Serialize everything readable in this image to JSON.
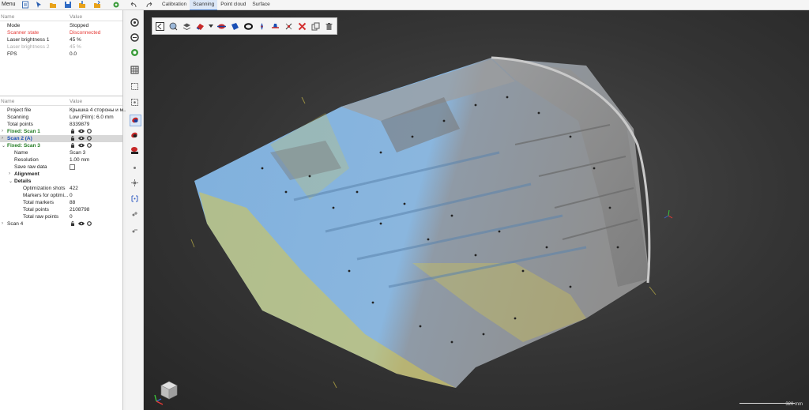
{
  "topbar": {
    "menu_label": "Menu",
    "quick_icons": [
      "new-project-icon",
      "scanner-icon",
      "open-folder-icon",
      "save-icon",
      "import-folder-icon",
      "export-folder-icon",
      "settings-icon",
      "undo-icon",
      "redo-icon"
    ],
    "tabs": [
      "Calibration",
      "Scanning",
      "Point cloud",
      "Surface"
    ],
    "active_tab": "Scanning"
  },
  "scanner_panel": {
    "col_name": "Name",
    "col_value": "Value",
    "rows": [
      {
        "name": "Mode",
        "value": "Stopped",
        "state": "normal"
      },
      {
        "name": "Scanner state",
        "value": "Disconnected",
        "state": "error"
      },
      {
        "name": "Laser brightness 1",
        "value": "45 %",
        "state": "normal"
      },
      {
        "name": "Laser brightness 2",
        "value": "45 %",
        "state": "disabled"
      },
      {
        "name": "FPS",
        "value": "0.0",
        "state": "normal"
      }
    ]
  },
  "project_panel": {
    "col_name": "Name",
    "col_value": "Value",
    "project_file_label": "Project file",
    "project_file_value": "Крышка 4 стороны и м...",
    "scanning_label": "Scanning",
    "scanning_value": "Low (Film): 6.0 mm",
    "total_points_label": "Total points",
    "total_points_value": "8339879",
    "scan1_label": "Fixed: Scan 1",
    "scan2_label": "Scan 2 (A)",
    "scan3_label": "Fixed: Scan 3",
    "name_label": "Name",
    "name_value": "Scan 3",
    "resolution_label": "Resolution",
    "resolution_value": "1.00 mm",
    "save_raw_label": "Save raw data",
    "alignment_label": "Alignment",
    "details_label": "Details",
    "opt_shots_label": "Optimization shots",
    "opt_shots_value": "422",
    "markers_opt_label": "Markers for optimi...",
    "markers_opt_value": "0",
    "total_markers_label": "Total markers",
    "total_markers_value": "88",
    "total_points2_label": "Total points",
    "total_points2_value": "2108798",
    "total_raw_label": "Total raw points",
    "total_raw_value": "0",
    "scan4_label": "Scan 4"
  },
  "viewport": {
    "scale_label": "320 mm",
    "toolbar_icons": [
      "back-icon",
      "select-by-color-icon",
      "layers-icon",
      "eraser-icon",
      "dropdown-arrow-icon",
      "cut-plane-icon",
      "blue-surface-icon",
      "ring-icon",
      "pin-icon",
      "hat-icon",
      "cross-out-icon",
      "remove-icon",
      "copy-icon",
      "trash-icon"
    ]
  },
  "colors": {
    "accent": "#4a7bc4",
    "scan1": "#1f7a1f",
    "scan2": "#1a4fb5",
    "scan3": "#1f7a1f",
    "error": "#e53935",
    "mesh_blue": "#7fb0dd",
    "mesh_yellow": "#d8c84a",
    "mesh_grey": "#8f8f8f"
  }
}
